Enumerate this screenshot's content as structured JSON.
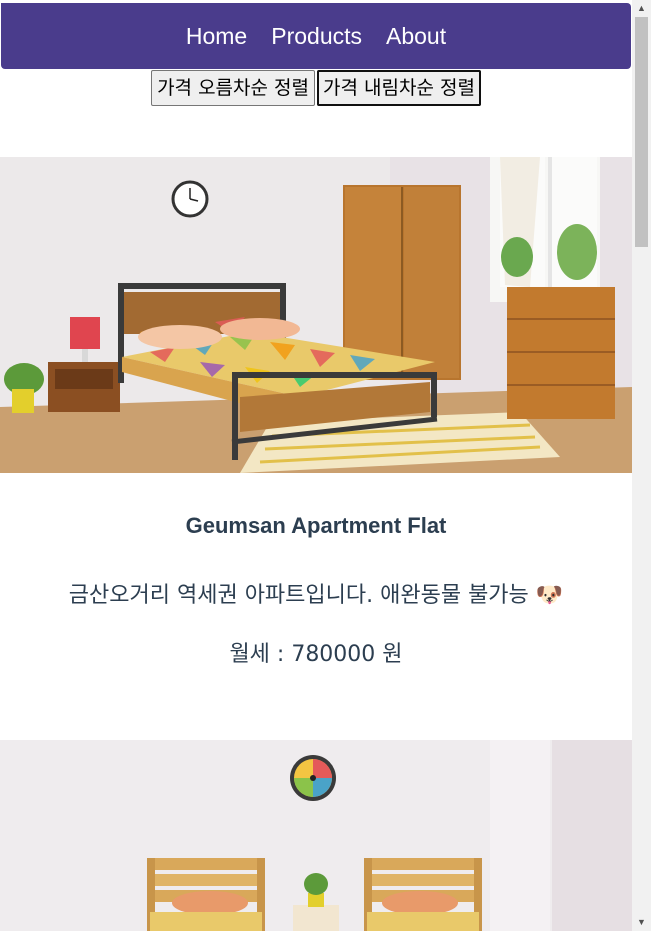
{
  "nav": {
    "items": [
      {
        "label": "Home"
      },
      {
        "label": "Products"
      },
      {
        "label": "About"
      }
    ]
  },
  "sort": {
    "asc_label": "가격 오름차순 정렬",
    "desc_label": "가격 내림차순 정렬"
  },
  "products": [
    {
      "title": "Geumsan Apartment Flat",
      "description": "금산오거리 역세권 아파트입니다. 애완동물 불가능",
      "emoji": "🐶",
      "price_text": "월세 : 780000 원"
    }
  ],
  "colors": {
    "nav_bg": "#4a3c8c",
    "text": "#2c3e50"
  }
}
